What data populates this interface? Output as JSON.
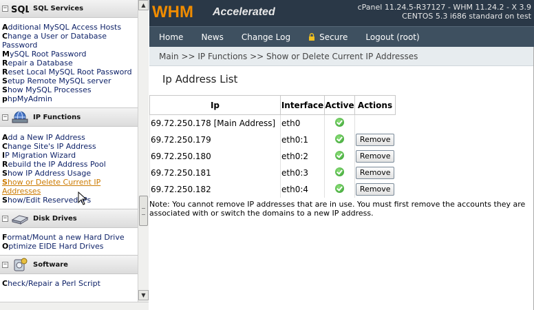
{
  "sidebar": {
    "sections": [
      {
        "title": "SQL Services",
        "icon": "sql-icon",
        "items": [
          {
            "first": "A",
            "rest": "dditional MySQL Access Hosts"
          },
          {
            "first": "C",
            "rest": "hange a User or Database Password"
          },
          {
            "first": "M",
            "rest": "ySQL Root Password"
          },
          {
            "first": "R",
            "rest": "epair a Database"
          },
          {
            "first": "R",
            "rest": "eset Local MySQL Root Password"
          },
          {
            "first": "S",
            "rest": "etup Remote MySQL server"
          },
          {
            "first": "S",
            "rest": "how MySQL Processes"
          },
          {
            "first": "p",
            "rest": "hpMyAdmin"
          }
        ]
      },
      {
        "title": "IP Functions",
        "icon": "ip-functions-icon",
        "items": [
          {
            "first": "A",
            "rest": "dd a New IP Address"
          },
          {
            "first": "C",
            "rest": "hange Site's IP Address"
          },
          {
            "first": "I",
            "rest": "P Migration Wizard"
          },
          {
            "first": "R",
            "rest": "ebuild the IP Address Pool"
          },
          {
            "first": "S",
            "rest": "how IP Address Usage"
          },
          {
            "first": "S",
            "rest": "how or Delete Current IP Addresses"
          },
          {
            "first": "S",
            "rest": "how/Edit Reserved IPs"
          }
        ]
      },
      {
        "title": "Disk Drives",
        "icon": "disk-drive-icon",
        "items": [
          {
            "first": "F",
            "rest": "ormat/Mount a new Hard Drive"
          },
          {
            "first": "O",
            "rest": "ptimize EIDE Hard Drives"
          }
        ]
      },
      {
        "title": "Software",
        "icon": "software-icon",
        "items": [
          {
            "first": "C",
            "rest": "heck/Repair a Perl Script"
          }
        ]
      }
    ]
  },
  "header": {
    "logo": "WHM",
    "logo_sub": "Accelerated",
    "version_line1": "cPanel 11.24.5-R37127 - WHM 11.24.2 - X 3.9",
    "version_line2": "CENTOS 5.3 i686 standard on test"
  },
  "nav": {
    "home": "Home",
    "news": "News",
    "changelog": "Change Log",
    "secure": "Secure",
    "logout": "Logout (root)"
  },
  "breadcrumb": "Main >> IP Functions >> Show or Delete Current IP Addresses",
  "page_title": "Ip Address List",
  "table": {
    "headers": [
      "Ip",
      "Interface",
      "Active",
      "Actions"
    ],
    "remove_label": "Remove",
    "rows": [
      {
        "ip": "69.72.250.178 [Main Address]",
        "iface": "eth0",
        "removable": false
      },
      {
        "ip": "69.72.250.179",
        "iface": "eth0:1",
        "removable": true
      },
      {
        "ip": "69.72.250.180",
        "iface": "eth0:2",
        "removable": true
      },
      {
        "ip": "69.72.250.181",
        "iface": "eth0:3",
        "removable": true
      },
      {
        "ip": "69.72.250.182",
        "iface": "eth0:4",
        "removable": true
      }
    ]
  },
  "note": "Note: You cannot remove IP addresses that are in use. You must first remove the accounts they are associated with or switch the domains to a new IP address.",
  "colors": {
    "header_bg": "#2a3847",
    "nav_bg": "#3e5060",
    "logo": "#f08c00",
    "active_link": "#cc7a00"
  }
}
